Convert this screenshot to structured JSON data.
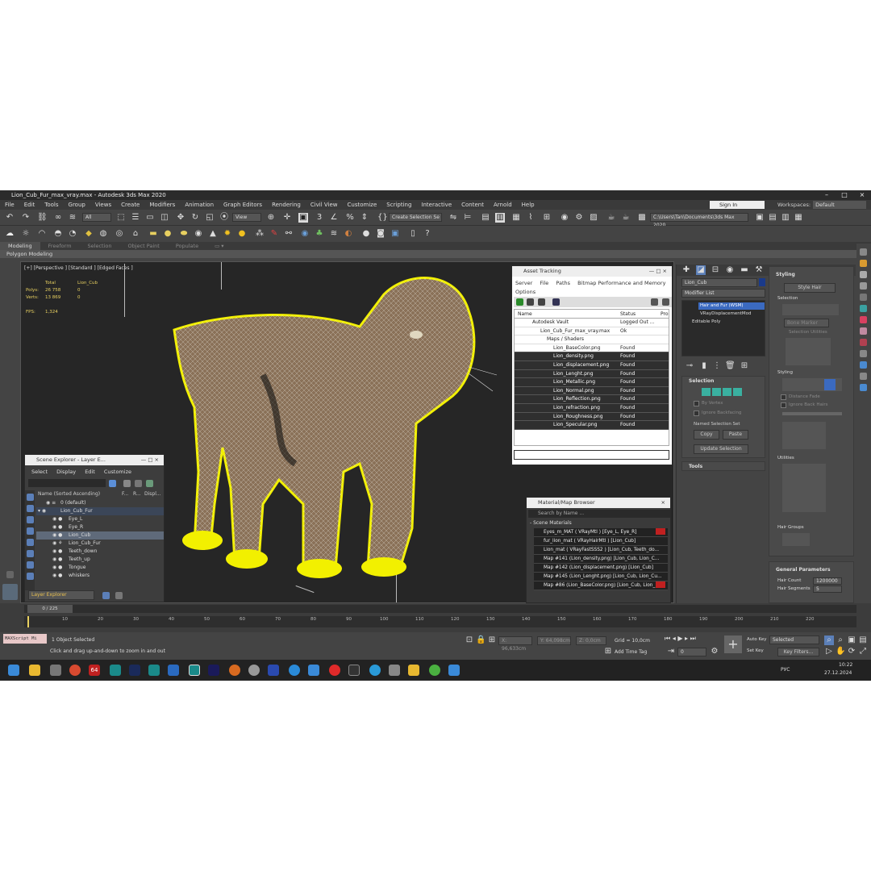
{
  "window": {
    "title": "Lion_Cub_Fur_max_vray.max - Autodesk 3ds Max 2020",
    "minimize": "–",
    "maximize": "□",
    "close": "×"
  },
  "menu": [
    "File",
    "Edit",
    "Tools",
    "Group",
    "Views",
    "Create",
    "Modifiers",
    "Animation",
    "Graph Editors",
    "Rendering",
    "Civil View",
    "Customize",
    "Scripting",
    "Interactive",
    "Content",
    "Arnold",
    "Help"
  ],
  "signin": {
    "label": "Sign In"
  },
  "workspaces": {
    "label": "Workspaces:",
    "value": "Default"
  },
  "toolbar": {
    "filter": "All",
    "view": "View",
    "selection_set": "Create Selection Se",
    "path": "C:\\Users\\Tan\\Documents\\3ds Max 2020"
  },
  "ribbon": {
    "tabs": [
      "Modeling",
      "Freeform",
      "Selection",
      "Object Paint",
      "Populate"
    ],
    "sub": "Polygon Modeling"
  },
  "viewport": {
    "label": "[+] [Perspective ] [Standard ] [Edged Faces ]",
    "stats": {
      "total": "Total",
      "object": "Lion_Cub",
      "polys_label": "Polys:",
      "polys_total": "26 758",
      "polys_obj": "0",
      "verts_label": "Verts:",
      "verts_total": "13 869",
      "verts_obj": "0",
      "fps_label": "FPS:",
      "fps": "1,324"
    }
  },
  "asset_tracking": {
    "title": "Asset Tracking",
    "menu": [
      "Server",
      "File",
      "Paths",
      "Bitmap Performance and Memory",
      "Options"
    ],
    "columns": [
      "Name",
      "Status",
      "Pro"
    ],
    "rows": [
      {
        "name": "Autodesk Vault",
        "status": "Logged Out ..."
      },
      {
        "name": "Lion_Cub_Fur_max_vray.max",
        "status": "Ok"
      },
      {
        "name": "Maps / Shaders",
        "status": ""
      },
      {
        "name": "Lion_BaseColor.png",
        "status": "Found"
      },
      {
        "name": "Lion_density.png",
        "status": "Found"
      },
      {
        "name": "Lion_displacement.png",
        "status": "Found"
      },
      {
        "name": "Lion_Lenght.png",
        "status": "Found"
      },
      {
        "name": "Lion_Metallic.png",
        "status": "Found"
      },
      {
        "name": "Lion_Normal.png",
        "status": "Found"
      },
      {
        "name": "Lion_Reflection.png",
        "status": "Found"
      },
      {
        "name": "Lion_refraction.png",
        "status": "Found"
      },
      {
        "name": "Lion_Roughness.png",
        "status": "Found"
      },
      {
        "name": "Lion_Specular.png",
        "status": "Found"
      }
    ]
  },
  "scene_explorer": {
    "title": "Scene Explorer - Layer E...",
    "menu": [
      "Select",
      "Display",
      "Edit",
      "Customize"
    ],
    "columns": [
      "Name (Sorted Ascending)",
      "F...",
      "R...",
      "Displ..."
    ],
    "rows": [
      "0 (default)",
      "Lion_Cub_Fur",
      "Eye_L",
      "Eye_R",
      "Lion_Cub",
      "Lion_Cub_Fur",
      "Teeth_down",
      "Teeth_up",
      "Tongue",
      "whiskers"
    ],
    "layer_dropdown": "Layer Explorer"
  },
  "material_browser": {
    "title": "Material/Map Browser",
    "search": "Search by Name ...",
    "section": "- Scene Materials",
    "rows": [
      "Eyes_m_MAT  ( VRayMtl )  [Eye_L, Eye_R]",
      "fur_lion_mat  ( VRayHairMtl )  [Lion_Cub]",
      "Lion_mat  ( VRayFastSSS2 )  [Lion_Cub, Teeth_do...",
      "Map #141 (Lion_density.png) [Lion_Cub, Lion_C...",
      "Map #142 (Lion_displacement.png) [Lion_Cub]",
      "Map #145 (Lion_Lenght.png) [Lion_Cub, Lion_Cu...",
      "Map #86 (Lion_BaseColor.png) [Lion_Cub, Lion_..."
    ]
  },
  "command_panel": {
    "object_name": "Lion_Cub",
    "modifier_list": "Modifier List",
    "stack": [
      "Hair and Fur (WSM)",
      "VRayDisplacementMod",
      "Editable Poly"
    ],
    "selection_rollout": "Selection",
    "by_vertex": "By Vertex",
    "ignore_backfacing": "Ignore Backfacing",
    "named_sets": "Named Selection Set",
    "copy": "Copy",
    "paste": "Paste",
    "update_selection": "Update Selection",
    "tools_rollout": "Tools",
    "styling_rollout": "Styling",
    "style_hair": "Style Hair",
    "selection_label": "Selection",
    "bone_marker": "Bone Marker",
    "selection_utilities": "Selection Utilities",
    "styling_label": "Styling",
    "distance_fade": "Distance Fade",
    "ignore_back_hairs": "Ignore Back Hairs",
    "utilities_label": "Utilities",
    "hair_groups": "Hair Groups",
    "general_params": "General Parameters",
    "hair_count_label": "Hair Count",
    "hair_count": "1200000",
    "hair_segments_label": "Hair Segments",
    "hair_segments": "5"
  },
  "timeline": {
    "frame": "0 / 225",
    "ticks": [
      "10",
      "20",
      "30",
      "40",
      "50",
      "60",
      "70",
      "80",
      "90",
      "100",
      "110",
      "120",
      "130",
      "140",
      "150",
      "160",
      "170",
      "180",
      "190",
      "200",
      "210",
      "220"
    ]
  },
  "status": {
    "script": "MAXScript Mi",
    "selected": "1 Object Selected",
    "prompt": "Click and drag up-and-down to zoom in and out",
    "x": "X: 96,633cm",
    "y": "Y: 64,098cm",
    "z": "Z: 0,0cm",
    "grid": "Grid = 10,0cm",
    "add_time_tag": "Add Time Tag",
    "auto_key": "Auto Key",
    "selected_dd": "Selected",
    "set_key": "Set Key",
    "key_filters": "Key Filters...",
    "frame_field": "0"
  },
  "taskbar": {
    "lang": "РУС",
    "time": "10:22",
    "date": "27.12.2024",
    "badge": "64"
  }
}
